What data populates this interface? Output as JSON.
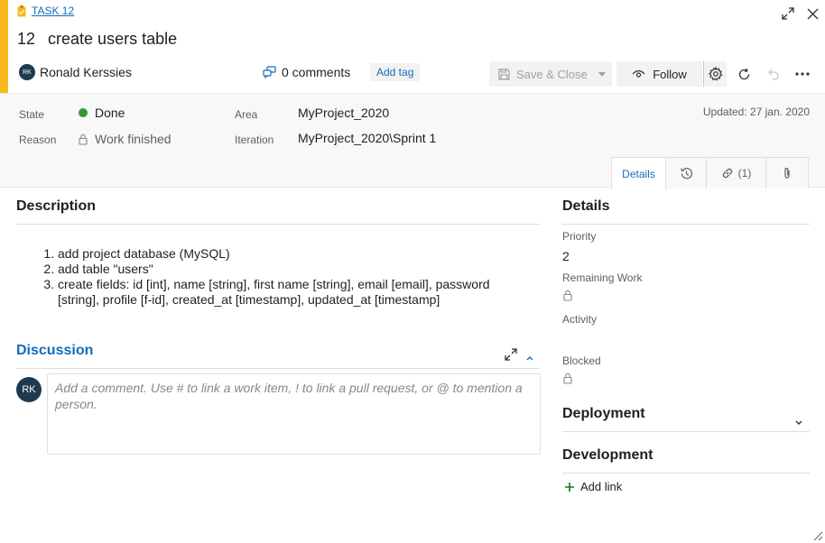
{
  "colors": {
    "accent": "#f8b91c",
    "link": "#106ebe",
    "done": "#339933",
    "add": "#107c10"
  },
  "header": {
    "type_label": "TASK 12",
    "id": "12",
    "title": "create users table",
    "owner": {
      "initials": "RK",
      "name": "Ronald Kerssies"
    },
    "comments": "0 comments",
    "add_tag": "Add tag",
    "save_close": "Save & Close",
    "follow": "Follow"
  },
  "fields": {
    "state_label": "State",
    "state_value": "Done",
    "reason_label": "Reason",
    "reason_value": "Work finished",
    "area_label": "Area",
    "area_value": "MyProject_2020",
    "iteration_label": "Iteration",
    "iteration_value": "MyProject_2020\\Sprint 1",
    "updated": "Updated: 27 jan. 2020"
  },
  "tabs": {
    "details": "Details",
    "links": "(1)"
  },
  "description": {
    "title": "Description",
    "items": [
      "add  project database (MySQL)",
      "add table \"users\"",
      "create fields: id [int], name [string], first name [string], email [email], password [string], profile [f-id], created_at [timestamp], updated_at [timestamp]"
    ]
  },
  "discussion": {
    "title": "Discussion",
    "avatar": "RK",
    "placeholder": "Add a comment. Use # to link a work item, ! to link a pull request, or @ to mention a person."
  },
  "details_panel": {
    "title": "Details",
    "priority_label": "Priority",
    "priority_value": "2",
    "remaining_label": "Remaining Work",
    "activity_label": "Activity",
    "blocked_label": "Blocked"
  },
  "deployment": {
    "title": "Deployment"
  },
  "development": {
    "title": "Development",
    "add_link": "Add link"
  }
}
